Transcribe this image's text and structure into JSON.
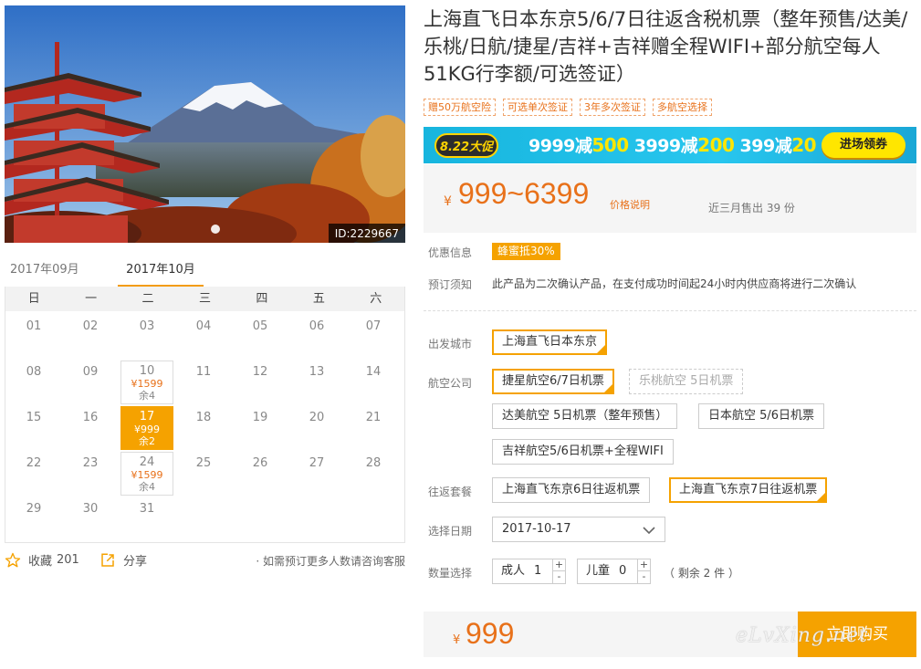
{
  "hero": {
    "id_label": "ID:2229667"
  },
  "calendar": {
    "months": [
      "2017年09月",
      "2017年10月"
    ],
    "weekdays": [
      "日",
      "一",
      "二",
      "三",
      "四",
      "五",
      "六"
    ],
    "weeks": [
      [
        {
          "d": "01"
        },
        {
          "d": "02"
        },
        {
          "d": "03"
        },
        {
          "d": "04"
        },
        {
          "d": "05"
        },
        {
          "d": "06"
        },
        {
          "d": "07"
        }
      ],
      [
        {
          "d": "08"
        },
        {
          "d": "09"
        },
        {
          "d": "10",
          "price": "¥1599",
          "stock": "余4"
        },
        {
          "d": "11"
        },
        {
          "d": "12"
        },
        {
          "d": "13"
        },
        {
          "d": "14"
        }
      ],
      [
        {
          "d": "15"
        },
        {
          "d": "16"
        },
        {
          "d": "17",
          "price": "¥999",
          "stock": "余2",
          "selected": true
        },
        {
          "d": "18"
        },
        {
          "d": "19"
        },
        {
          "d": "20"
        },
        {
          "d": "21"
        }
      ],
      [
        {
          "d": "22"
        },
        {
          "d": "23"
        },
        {
          "d": "24",
          "price": "¥1599",
          "stock": "余4"
        },
        {
          "d": "25"
        },
        {
          "d": "26"
        },
        {
          "d": "27"
        },
        {
          "d": "28"
        }
      ],
      [
        {
          "d": "29"
        },
        {
          "d": "30"
        },
        {
          "d": "31"
        }
      ]
    ]
  },
  "actions": {
    "favorite_label": "收藏",
    "favorite_count": "201",
    "share_label": "分享",
    "note": "· 如需预订更多人数请咨询客服"
  },
  "product": {
    "title": "上海直飞日本东京5/6/7日往返含税机票（整年预售/达美/乐桃/日航/捷星/吉祥+吉祥赠全程WIFI+部分航空每人51KG行李额/可选签证）",
    "tags": [
      "赠50万航空险",
      "可选单次签证",
      "3年多次签证",
      "多航空选择"
    ]
  },
  "promo": {
    "badge": "8.22大促",
    "deals": [
      {
        "spend": "9999减",
        "off": "500"
      },
      {
        "spend": "3999减",
        "off": "200"
      },
      {
        "spend": "399减",
        "off": "20"
      }
    ],
    "button": "进场领券"
  },
  "price": {
    "currency": "¥",
    "range": "999~6399",
    "note": "价格说明",
    "sold": "近三月售出 39 份"
  },
  "info": {
    "discount_label": "优惠信息",
    "discount_badge": "蜂蜜抵30%",
    "notice_label": "预订须知",
    "notice_text": "此产品为二次确认产品，在支付成功时间起24小时内供应商将进行二次确认"
  },
  "options": {
    "departure_label": "出发城市",
    "departure": "上海直飞日本东京",
    "airline_label": "航空公司",
    "airlines": [
      "捷星航空6/7日机票",
      "乐桃航空 5日机票",
      "达美航空 5日机票（整年预售）",
      "日本航空 5/6日机票",
      "吉祥航空5/6日机票+全程WIFI"
    ],
    "package_label": "往返套餐",
    "packages": [
      "上海直飞东京6日往返机票",
      "上海直飞东京7日往返机票"
    ],
    "date_label": "选择日期",
    "date_value": "2017-10-17",
    "qty_label": "数量选择",
    "adult_label": "成人",
    "adult_value": "1",
    "child_label": "儿童",
    "child_value": "0",
    "remain": "（ 剩余 2 件 ）"
  },
  "buy": {
    "currency": "¥",
    "total": "999",
    "button": "立即购买"
  },
  "watermark": "eLvXing.net",
  "colors": {
    "accent": "#f5a200",
    "price": "#e8711a",
    "promo_bg": "#1fb8e3"
  }
}
